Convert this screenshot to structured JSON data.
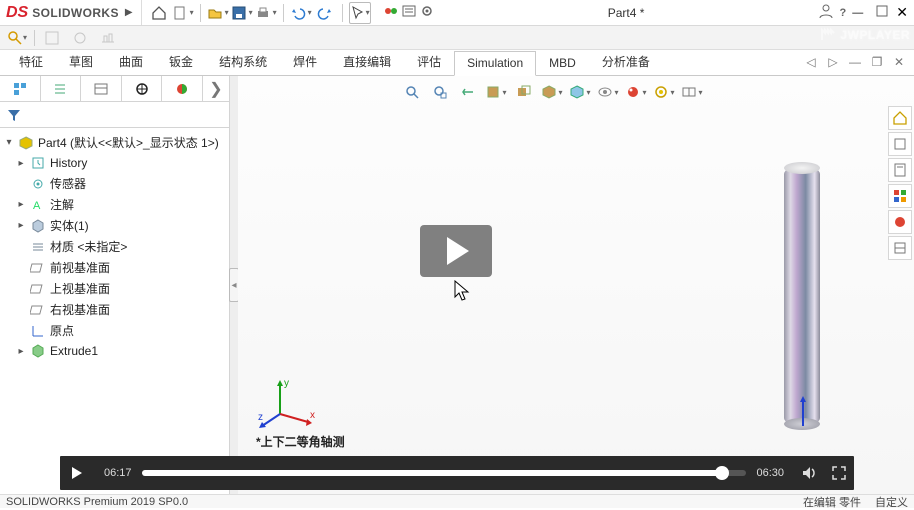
{
  "app": {
    "brand_ds": "DS",
    "brand_sw": "SOLIDWORKS",
    "doc_title": "Part4 *"
  },
  "tabs": {
    "items": [
      "特征",
      "草图",
      "曲面",
      "钣金",
      "结构系统",
      "焊件",
      "直接编辑",
      "评估",
      "Simulation",
      "MBD",
      "分析准备"
    ],
    "active_index": 8
  },
  "tree": {
    "root": "Part4 (默认<<默认>_显示状态 1>)",
    "nodes": [
      {
        "exp": "▸",
        "icon": "history",
        "label": "History"
      },
      {
        "exp": "",
        "icon": "sensor",
        "label": "传感器"
      },
      {
        "exp": "▸",
        "icon": "annotation",
        "label": "注解"
      },
      {
        "exp": "▸",
        "icon": "solid",
        "label": "实体(1)"
      },
      {
        "exp": "",
        "icon": "material",
        "label": "材质 <未指定>"
      },
      {
        "exp": "",
        "icon": "plane",
        "label": "前视基准面"
      },
      {
        "exp": "",
        "icon": "plane",
        "label": "上视基准面"
      },
      {
        "exp": "",
        "icon": "plane",
        "label": "右视基准面"
      },
      {
        "exp": "",
        "icon": "origin",
        "label": "原点"
      },
      {
        "exp": "▸",
        "icon": "extrude",
        "label": "Extrude1"
      }
    ]
  },
  "triad": {
    "x": "x",
    "y": "y",
    "z": "z"
  },
  "viewport": {
    "annotation": "*上下二等角轴测"
  },
  "status": {
    "left": "SOLIDWORKS Premium 2019 SP0.0",
    "mid": "在编辑 零件",
    "right": "自定义"
  },
  "player": {
    "current": "06:17",
    "total": "06:30",
    "progress_pct": 96
  },
  "watermark": "JWPLAYER"
}
